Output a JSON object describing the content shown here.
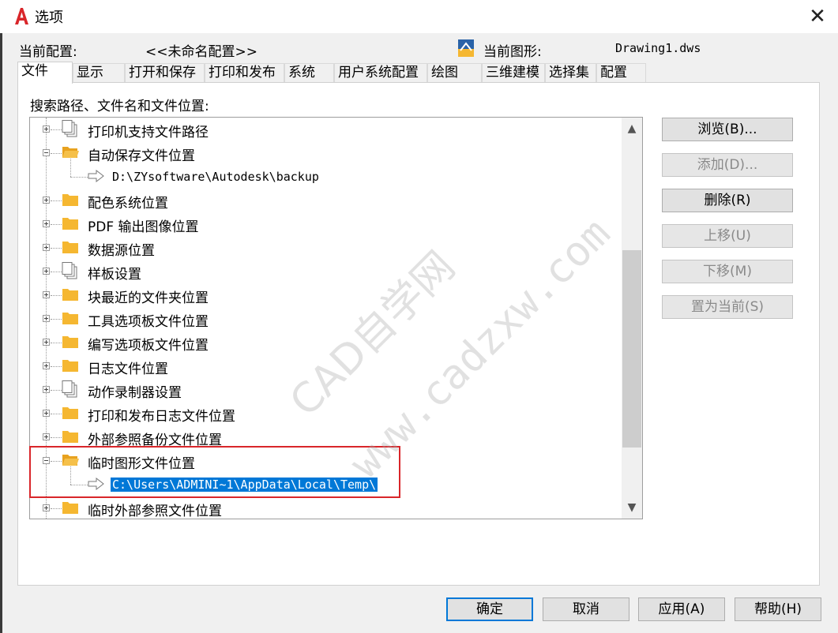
{
  "window": {
    "title": "选项",
    "close_label": "✕"
  },
  "profile": {
    "current_profile_label": "当前配置:",
    "current_profile_value": "<<未命名配置>>",
    "current_drawing_label": "当前图形:",
    "current_drawing_value": "Drawing1.dws"
  },
  "tabs": [
    {
      "label": "文件",
      "active": true
    },
    {
      "label": "显示"
    },
    {
      "label": "打开和保存"
    },
    {
      "label": "打印和发布"
    },
    {
      "label": "系统"
    },
    {
      "label": "用户系统配置"
    },
    {
      "label": "绘图"
    },
    {
      "label": "三维建模"
    },
    {
      "label": "选择集"
    },
    {
      "label": "配置"
    }
  ],
  "panel": {
    "section_label": "搜索路径、文件名和文件位置:"
  },
  "tree": {
    "items": [
      {
        "label": "打印机支持文件路径",
        "icon": "multi-page-icon",
        "expanded": false
      },
      {
        "label": "自动保存文件位置",
        "icon": "folder-open-icon",
        "expanded": true
      },
      {
        "label": "D:\\ZYsoftware\\Autodesk\\backup",
        "icon": "arrow-right-icon",
        "child": true
      },
      {
        "label": "配色系统位置",
        "icon": "folder-icon",
        "expanded": false
      },
      {
        "label": "PDF 输出图像位置",
        "icon": "folder-icon",
        "expanded": false
      },
      {
        "label": "数据源位置",
        "icon": "folder-icon",
        "expanded": false
      },
      {
        "label": "样板设置",
        "icon": "multi-page-icon",
        "expanded": false
      },
      {
        "label": "块最近的文件夹位置",
        "icon": "folder-icon",
        "expanded": false
      },
      {
        "label": "工具选项板文件位置",
        "icon": "folder-icon",
        "expanded": false
      },
      {
        "label": "编写选项板文件位置",
        "icon": "folder-icon",
        "expanded": false
      },
      {
        "label": "日志文件位置",
        "icon": "folder-icon",
        "expanded": false
      },
      {
        "label": "动作录制器设置",
        "icon": "multi-page-icon",
        "expanded": false
      },
      {
        "label": "打印和发布日志文件位置",
        "icon": "folder-icon",
        "expanded": false
      },
      {
        "label": "外部参照备份文件位置",
        "icon": "folder-icon",
        "expanded": false
      },
      {
        "label": "临时图形文件位置",
        "icon": "folder-open-icon",
        "expanded": true
      },
      {
        "label": "C:\\Users\\ADMINI~1\\AppData\\Local\\Temp\\",
        "icon": "arrow-right-icon",
        "child": true,
        "selected": true
      },
      {
        "label": "临时外部参照文件位置",
        "icon": "folder-icon",
        "expanded": false
      }
    ]
  },
  "side_buttons": {
    "browse": "浏览(B)...",
    "add": "添加(D)...",
    "delete": "删除(R)",
    "move_up": "上移(U)",
    "move_down": "下移(M)",
    "set_current": "置为当前(S)"
  },
  "bottom_buttons": {
    "ok": "确定",
    "cancel": "取消",
    "apply": "应用(A)",
    "help": "帮助(H)"
  },
  "watermark": {
    "line1": "CAD自学网",
    "line2": "www.cadzxw.com"
  },
  "colors": {
    "selection": "#0078d7",
    "highlight_box": "#d9262a",
    "folder": "#f5b731",
    "app_icon": "#d9262a"
  }
}
